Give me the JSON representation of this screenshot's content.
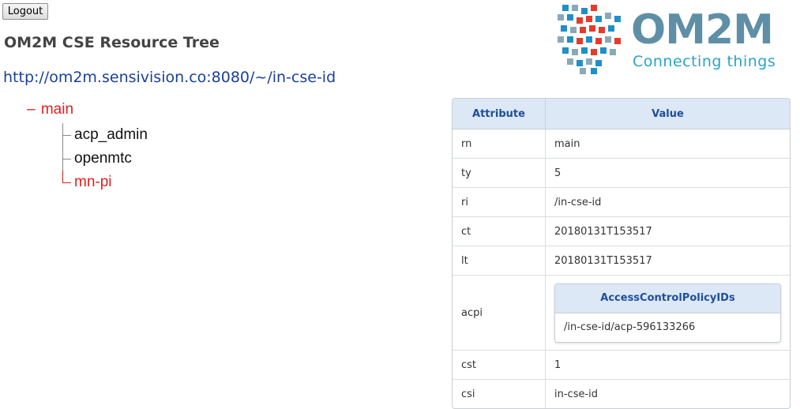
{
  "header": {
    "logout_label": "Logout",
    "title": "OM2M CSE Resource Tree",
    "cse_url": "http://om2m.sensivision.co:8080/~/in-cse-id"
  },
  "logo": {
    "title": "OM2M",
    "subtitle": "Connecting things",
    "colors": [
      "#1f8fc7",
      "#e53b2a",
      "#5f8fa6",
      "#8aa9b8"
    ]
  },
  "tree": {
    "root": {
      "toggle": "–",
      "label": "main"
    },
    "children": [
      "acp_admin",
      "openmtc",
      "mn-pi"
    ]
  },
  "table": {
    "headers": {
      "attribute": "Attribute",
      "value": "Value"
    },
    "rows": [
      {
        "k": "rn",
        "v": "main"
      },
      {
        "k": "ty",
        "v": "5"
      },
      {
        "k": "ri",
        "v": "/in-cse-id"
      },
      {
        "k": "ct",
        "v": "20180131T153517"
      },
      {
        "k": "lt",
        "v": "20180131T153517"
      },
      {
        "k": "acpi",
        "nested_header": "AccessControlPolicyIDs",
        "nested_value": "/in-cse-id/acp-596133266"
      },
      {
        "k": "cst",
        "v": "1"
      },
      {
        "k": "csi",
        "v": "in-cse-id"
      }
    ]
  }
}
